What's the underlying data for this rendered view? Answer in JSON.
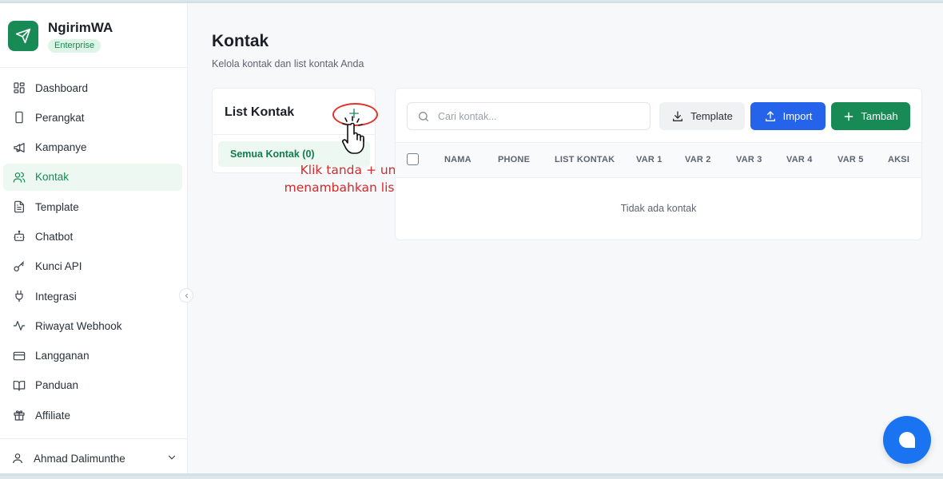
{
  "brand": {
    "name": "NgirimWA",
    "badge": "Enterprise"
  },
  "sidebar": {
    "items": [
      {
        "label": "Dashboard",
        "icon": "dashboard-icon"
      },
      {
        "label": "Perangkat",
        "icon": "device-icon"
      },
      {
        "label": "Kampanye",
        "icon": "megaphone-icon"
      },
      {
        "label": "Kontak",
        "icon": "users-icon",
        "active": true
      },
      {
        "label": "Template",
        "icon": "file-text-icon"
      },
      {
        "label": "Chatbot",
        "icon": "bot-icon"
      },
      {
        "label": "Kunci API",
        "icon": "key-icon"
      },
      {
        "label": "Integrasi",
        "icon": "plug-icon"
      },
      {
        "label": "Riwayat Webhook",
        "icon": "activity-icon"
      },
      {
        "label": "Langganan",
        "icon": "credit-card-icon"
      },
      {
        "label": "Panduan",
        "icon": "book-icon"
      },
      {
        "label": "Affiliate",
        "icon": "gift-icon"
      }
    ],
    "user": {
      "name": "Ahmad Dalimunthe"
    }
  },
  "page": {
    "title": "Kontak",
    "subtitle": "Kelola kontak dan list kontak Anda"
  },
  "list_panel": {
    "title": "List Kontak",
    "all_label": "Semua Kontak (0)"
  },
  "annotation": {
    "line1": "Klik tanda + untuk",
    "line2": "menambahkan list grup"
  },
  "toolbar": {
    "search_placeholder": "Cari kontak...",
    "template_label": "Template",
    "import_label": "Import",
    "add_label": "Tambah"
  },
  "table": {
    "headers": [
      "NAMA",
      "PHONE",
      "LIST KONTAK",
      "VAR 1",
      "VAR 2",
      "VAR 3",
      "VAR 4",
      "VAR 5",
      "AKSI"
    ],
    "empty_text": "Tidak ada kontak"
  },
  "colors": {
    "primary_green": "#178a56",
    "import_blue": "#2563eb",
    "annotation_red": "#d42a2a",
    "fab_blue": "#1a73f0"
  }
}
